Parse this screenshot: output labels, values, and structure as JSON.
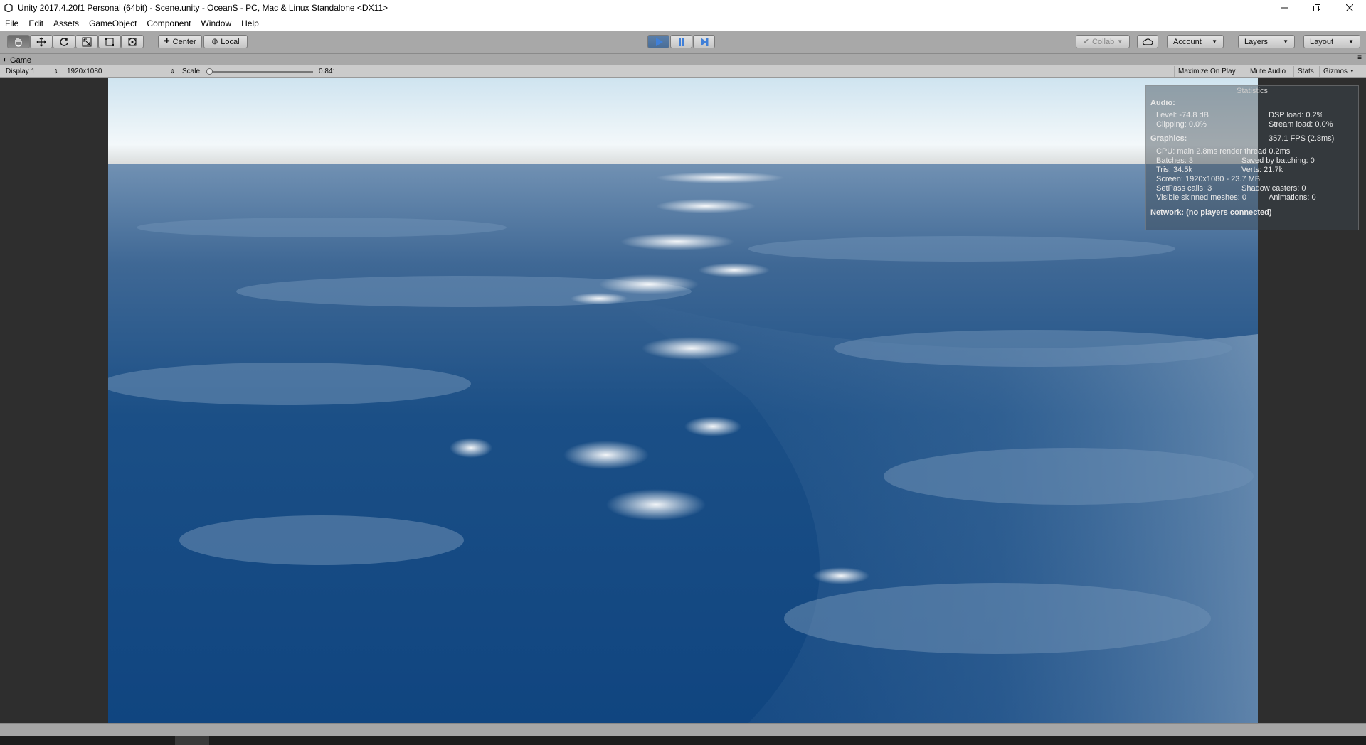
{
  "window": {
    "title": "Unity 2017.4.20f1 Personal (64bit) - Scene.unity - OceanS - PC, Mac & Linux Standalone <DX11>",
    "minimize_icon": "minimize-icon",
    "restore_icon": "restore-icon",
    "close_icon": "close-icon"
  },
  "menu": [
    "File",
    "Edit",
    "Assets",
    "GameObject",
    "Component",
    "Window",
    "Help"
  ],
  "toolbar": {
    "tools": [
      "hand-tool-icon",
      "move-tool-icon",
      "rotate-tool-icon",
      "scale-tool-icon",
      "rect-tool-icon",
      "transform-tool-icon"
    ],
    "pivot_label": "Center",
    "space_label": "Local",
    "collab_label": "Collab",
    "account_label": "Account",
    "layers_label": "Layers",
    "layout_label": "Layout"
  },
  "game_tab": {
    "label": "Game"
  },
  "game_toolbar": {
    "display": "Display 1",
    "resolution": "1920x1080",
    "scale_label": "Scale",
    "scale_value": "0.84:",
    "scale_fraction": 0.0,
    "maximize_label": "Maximize On Play",
    "mute_label": "Mute Audio",
    "stats_label": "Stats",
    "gizmos_label": "Gizmos"
  },
  "statistics": {
    "title": "Statistics",
    "audio_head": "Audio:",
    "level": "Level: -74.8 dB",
    "clipping": "Clipping: 0.0%",
    "dsp_load": "DSP load: 0.2%",
    "stream_load": "Stream load: 0.0%",
    "graphics_head": "Graphics:",
    "fps": "357.1 FPS (2.8ms)",
    "cpu": "CPU: main 2.8ms  render thread 0.2ms",
    "batches": "Batches: 3",
    "saved_batching": "Saved by batching: 0",
    "tris": "Tris: 34.5k",
    "verts": "Verts: 21.7k",
    "screen": "Screen: 1920x1080 - 23.7 MB",
    "setpass": "SetPass calls: 3",
    "shadow_casters": "Shadow casters: 0",
    "skinned": "Visible skinned meshes: 0",
    "animations": "Animations: 0",
    "network": "Network: (no players connected)"
  },
  "colors": {
    "sky_top": "#e6f1f7",
    "ocean_deep": "#10457f",
    "ocean_light": "#5a81ab",
    "play_accent": "#3f7fd8"
  }
}
